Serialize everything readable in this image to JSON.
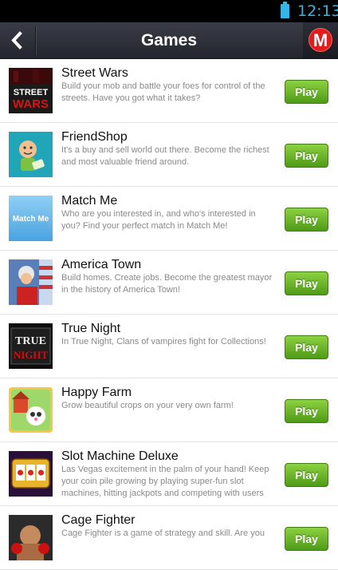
{
  "status_bar": {
    "time": "12:13"
  },
  "header": {
    "back_icon": "chevron-left-icon",
    "title": "Games",
    "logo": "M"
  },
  "games": [
    {
      "name": "Street Wars",
      "description": "Build your mob and battle your foes for control of the streets. Have you got what it takes?",
      "play_label": "Play",
      "thumb_text": "STREET WARS"
    },
    {
      "name": "FriendShop",
      "description": "It's a buy and sell world out there. Become the richest and most valuable friend around.",
      "play_label": "Play",
      "thumb_text": ""
    },
    {
      "name": "Match Me",
      "description": "Who are you interested in, and who's interested in you? Find your perfect match in Match Me!",
      "play_label": "Play",
      "thumb_text": "Match Me"
    },
    {
      "name": "America Town",
      "description": "Build homes. Create jobs. Become the greatest mayor in the history of America Town!",
      "play_label": "Play",
      "thumb_text": ""
    },
    {
      "name": "True Night",
      "description": "In True Night, Clans of vampires fight for Collections!",
      "play_label": "Play",
      "thumb_text": "TRUE NIGHT"
    },
    {
      "name": "Happy Farm",
      "description": "Grow beautiful crops on your very own farm!",
      "play_label": "Play",
      "thumb_text": ""
    },
    {
      "name": "Slot Machine Deluxe",
      "description": "Las Vegas excitement in the palm of your hand! Keep your coin pile growing by playing super-fun slot machines, hitting jackpots and competing with users",
      "play_label": "Play",
      "thumb_text": ""
    },
    {
      "name": "Cage Fighter",
      "description": "Cage Fighter is a game of strategy and skill. Are you",
      "play_label": "Play",
      "thumb_text": ""
    }
  ]
}
